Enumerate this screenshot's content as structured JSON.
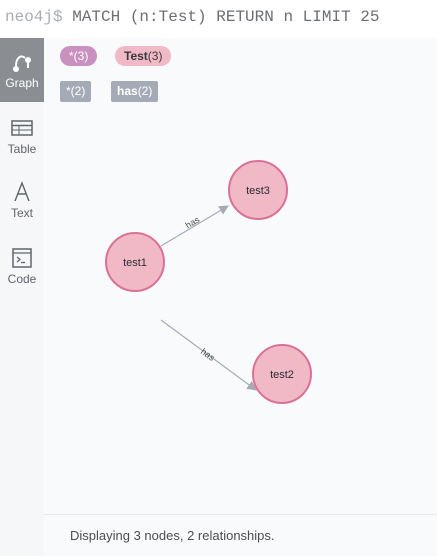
{
  "query": {
    "prompt": "neo4j$",
    "text": "MATCH (n:Test) RETURN n LIMIT 25"
  },
  "sidebar": {
    "items": [
      {
        "label": "Graph",
        "icon": "graph-icon",
        "active": true
      },
      {
        "label": "Table",
        "icon": "table-icon",
        "active": false
      },
      {
        "label": "Text",
        "icon": "text-icon",
        "active": false
      },
      {
        "label": "Code",
        "icon": "code-icon",
        "active": false
      }
    ]
  },
  "legend": {
    "all_nodes": "*(3)",
    "label_name": "Test",
    "label_count": "(3)",
    "all_relationships": "*(2)",
    "rel_type": "has",
    "rel_count": "(2)"
  },
  "graph": {
    "nodes": [
      {
        "id": "test1",
        "caption": "test1"
      },
      {
        "id": "test2",
        "caption": "test2"
      },
      {
        "id": "test3",
        "caption": "test3"
      }
    ],
    "relationships": [
      {
        "from": "test1",
        "to": "test3",
        "type": "has"
      },
      {
        "from": "test1",
        "to": "test2",
        "type": "has"
      }
    ],
    "colors": {
      "node_fill": "#f1b8c6",
      "node_stroke": "#da7298",
      "edge": "#a5abb6",
      "text": "#2a2c34"
    }
  },
  "status": {
    "text": "Displaying 3 nodes, 2 relationships."
  },
  "colors": {
    "sidebar_bg": "#f6f7f9",
    "active_tab": "#8a8d91",
    "pill_all_nodes": "#c990c0",
    "pill_label": "#f1b8c6",
    "rel_tag": "#a5abb6"
  }
}
